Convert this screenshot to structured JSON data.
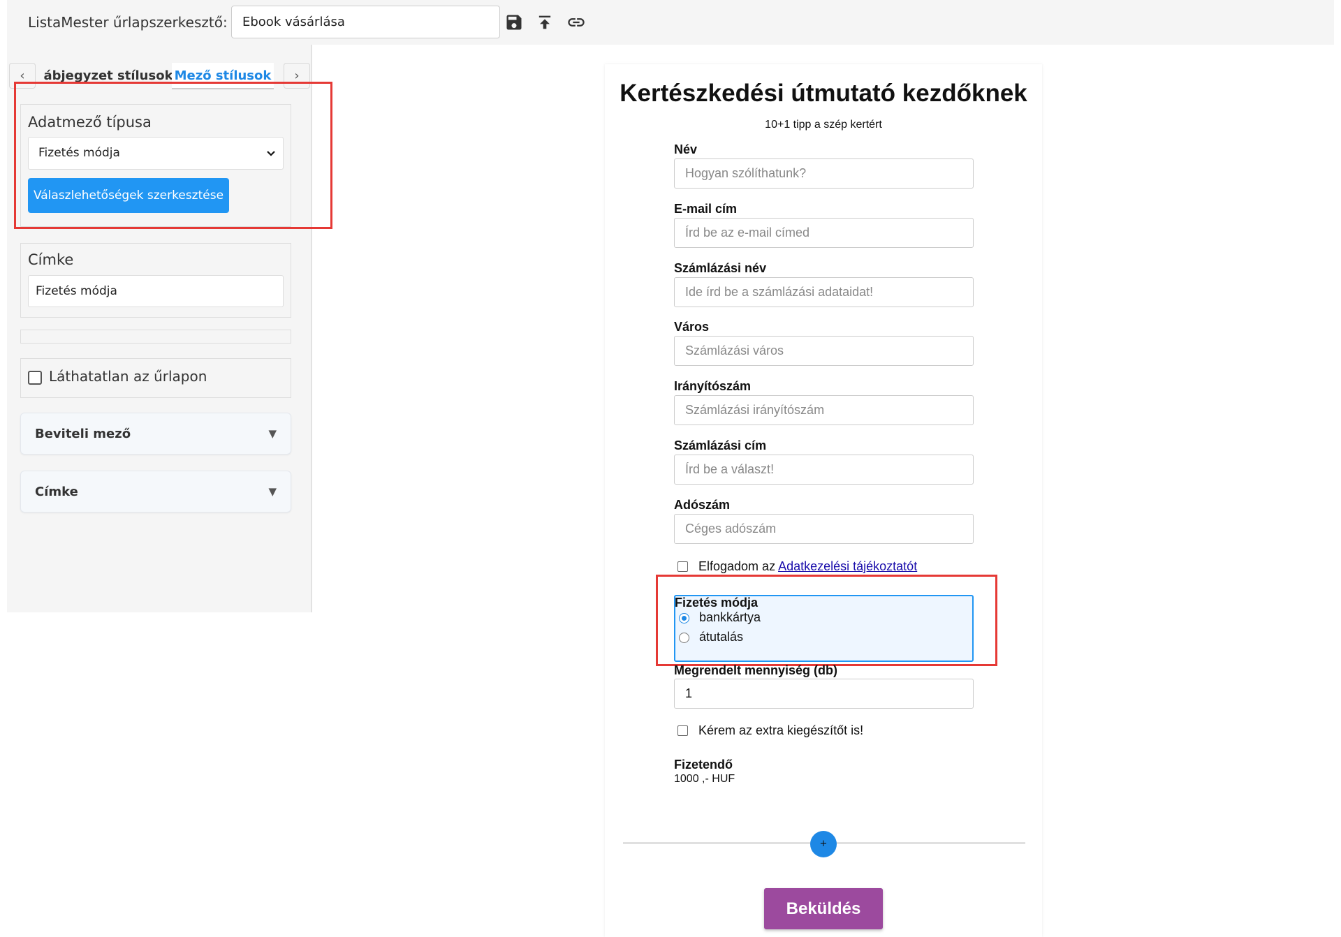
{
  "app": {
    "title": "ListaMester űrlapszerkesztő:",
    "form_name": "Ebook vásárlása"
  },
  "toolbar": {
    "icons": [
      "save-icon",
      "upload-icon",
      "link-icon"
    ]
  },
  "tabs": {
    "prev_arrow": "‹",
    "next_arrow": "›",
    "prev_label": "ábjegyzet stílusok",
    "active_label": "Mező stílusok"
  },
  "sidebar": {
    "field_type": {
      "title": "Adatmező típusa",
      "selected": "Fizetés módja",
      "edit_button": "Válaszlehetőségek szerkesztése"
    },
    "label_section": {
      "title": "Címke",
      "value": "Fizetés módja"
    },
    "hidden_checkbox": {
      "label": "Láthatatlan az űrlapon",
      "checked": false
    },
    "accordions": [
      "Beviteli mező",
      "Címke"
    ],
    "accordion_arrow": "▼"
  },
  "form": {
    "title": "Kertészkedési útmutató kezdőknek",
    "subtitle": "10+1 tipp a szép kertért",
    "fields": [
      {
        "label": "Név",
        "placeholder": "Hogyan szólíthatunk?"
      },
      {
        "label": "E-mail cím",
        "placeholder": "Írd be az e-mail címed"
      },
      {
        "label": "Számlázási név",
        "placeholder": "Ide írd be a számlázási adataidat!"
      },
      {
        "label": "Város",
        "placeholder": "Számlázási város"
      },
      {
        "label": "Irányítószám",
        "placeholder": "Számlázási irányítószám"
      },
      {
        "label": "Számlázási cím",
        "placeholder": "Írd be a választ!"
      },
      {
        "label": "Adószám",
        "placeholder": "Céges adószám"
      }
    ],
    "privacy": {
      "text": "Elfogadom az ",
      "link": "Adatkezelési tájékoztatót"
    },
    "payment": {
      "label": "Fizetés módja",
      "options": [
        "bankkártya",
        "átutalás"
      ],
      "selected": "bankkártya"
    },
    "quantity": {
      "label": "Megrendelt mennyiség (db)",
      "value": "1"
    },
    "extra_checkbox": "Kérem az extra kiegészítőt is!",
    "total": {
      "label": "Fizetendő",
      "value": "1000 ,- HUF"
    },
    "add_button": "+",
    "submit": "Beküldés"
  },
  "colors": {
    "accent_blue": "#2196f3",
    "submit_purple": "#9c4a9e",
    "highlight_red": "#e53935"
  }
}
